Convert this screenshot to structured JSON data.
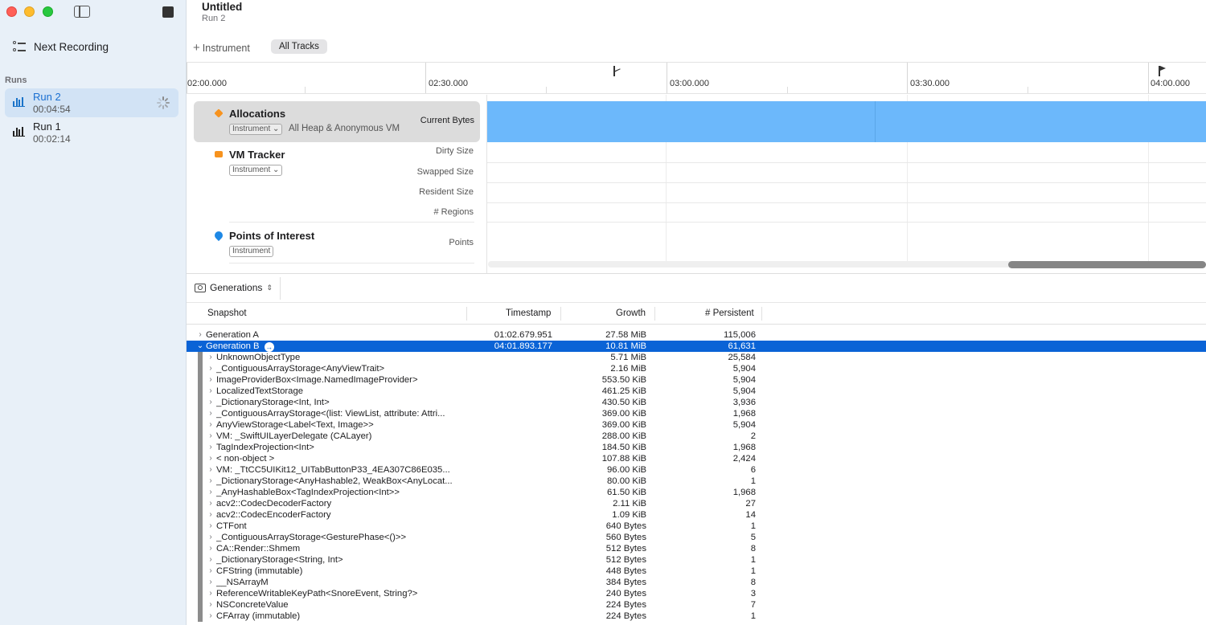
{
  "sidebar": {
    "next_recording": "Next Recording",
    "runs_label": "Runs",
    "runs": [
      {
        "name": "Run 2",
        "time": "00:04:54",
        "selected": true
      },
      {
        "name": "Run 1",
        "time": "00:02:14",
        "selected": false
      }
    ]
  },
  "header": {
    "title": "Untitled",
    "subtitle": "Run 2"
  },
  "toolbar": {
    "add_instrument": "Instrument",
    "all_tracks": "All Tracks"
  },
  "timeline": {
    "ticks": [
      "02:00.000",
      "02:30.000",
      "03:00.000",
      "03:30.000",
      "04:00.000"
    ]
  },
  "tracks": {
    "allocations": {
      "name": "Allocations",
      "badge": "Instrument",
      "description": "All Heap & Anonymous VM",
      "meta": "Current Bytes",
      "color": "#f7931e"
    },
    "vm_tracker": {
      "name": "VM Tracker",
      "badge": "Instrument",
      "meta": [
        "Dirty Size",
        "Swapped Size",
        "Resident Size",
        "# Regions"
      ],
      "color": "#f7931e"
    },
    "poi": {
      "name": "Points of Interest",
      "badge": "Instrument",
      "meta": "Points",
      "color": "#1e88e5"
    }
  },
  "detail": {
    "selector": "Generations"
  },
  "table": {
    "columns": {
      "snapshot": "Snapshot",
      "timestamp": "Timestamp",
      "growth": "Growth",
      "persistent": "# Persistent"
    },
    "generations": [
      {
        "name": "Generation A",
        "timestamp": "01:02.679.951",
        "growth": "27.58 MiB",
        "persistent": "115,006",
        "selected": false
      },
      {
        "name": "Generation B",
        "timestamp": "04:01.893.177",
        "growth": "10.81 MiB",
        "persistent": "61,631",
        "selected": true
      }
    ],
    "children": [
      {
        "name": "UnknownObjectType",
        "growth": "5.71 MiB",
        "persistent": "25,584"
      },
      {
        "name": "_ContiguousArrayStorage<AnyViewTrait>",
        "growth": "2.16 MiB",
        "persistent": "5,904"
      },
      {
        "name": "ImageProviderBox<Image.NamedImageProvider>",
        "growth": "553.50 KiB",
        "persistent": "5,904"
      },
      {
        "name": "LocalizedTextStorage",
        "growth": "461.25 KiB",
        "persistent": "5,904"
      },
      {
        "name": "_DictionaryStorage<Int, Int>",
        "growth": "430.50 KiB",
        "persistent": "3,936"
      },
      {
        "name": "_ContiguousArrayStorage<(list: ViewList, attribute: Attri...",
        "growth": "369.00 KiB",
        "persistent": "1,968"
      },
      {
        "name": "AnyViewStorage<Label<Text, Image>>",
        "growth": "369.00 KiB",
        "persistent": "5,904"
      },
      {
        "name": "VM: _SwiftUILayerDelegate (CALayer)",
        "growth": "288.00 KiB",
        "persistent": "2"
      },
      {
        "name": "TagIndexProjection<Int>",
        "growth": "184.50 KiB",
        "persistent": "1,968"
      },
      {
        "name": "< non-object >",
        "growth": "107.88 KiB",
        "persistent": "2,424"
      },
      {
        "name": "VM: _TtCC5UIKit12_UITabButtonP33_4EA307C86E035...",
        "growth": "96.00 KiB",
        "persistent": "6"
      },
      {
        "name": "_DictionaryStorage<AnyHashable2, WeakBox<AnyLocat...",
        "growth": "80.00 KiB",
        "persistent": "1"
      },
      {
        "name": "_AnyHashableBox<TagIndexProjection<Int>>",
        "growth": "61.50 KiB",
        "persistent": "1,968"
      },
      {
        "name": "acv2::CodecDecoderFactory",
        "growth": "2.11 KiB",
        "persistent": "27"
      },
      {
        "name": "acv2::CodecEncoderFactory",
        "growth": "1.09 KiB",
        "persistent": "14"
      },
      {
        "name": "CTFont",
        "growth": "640 Bytes",
        "persistent": "1"
      },
      {
        "name": "_ContiguousArrayStorage<GesturePhase<()>>",
        "growth": "560 Bytes",
        "persistent": "5"
      },
      {
        "name": "CA::Render::Shmem",
        "growth": "512 Bytes",
        "persistent": "8"
      },
      {
        "name": "_DictionaryStorage<String, Int>",
        "growth": "512 Bytes",
        "persistent": "1"
      },
      {
        "name": "CFString (immutable)",
        "growth": "448 Bytes",
        "persistent": "1"
      },
      {
        "name": "__NSArrayM",
        "growth": "384 Bytes",
        "persistent": "8"
      },
      {
        "name": "ReferenceWritableKeyPath<SnoreEvent, String?>",
        "growth": "240 Bytes",
        "persistent": "3"
      },
      {
        "name": "NSConcreteValue",
        "growth": "224 Bytes",
        "persistent": "7"
      },
      {
        "name": "CFArray (immutable)",
        "growth": "224 Bytes",
        "persistent": "1"
      }
    ]
  }
}
